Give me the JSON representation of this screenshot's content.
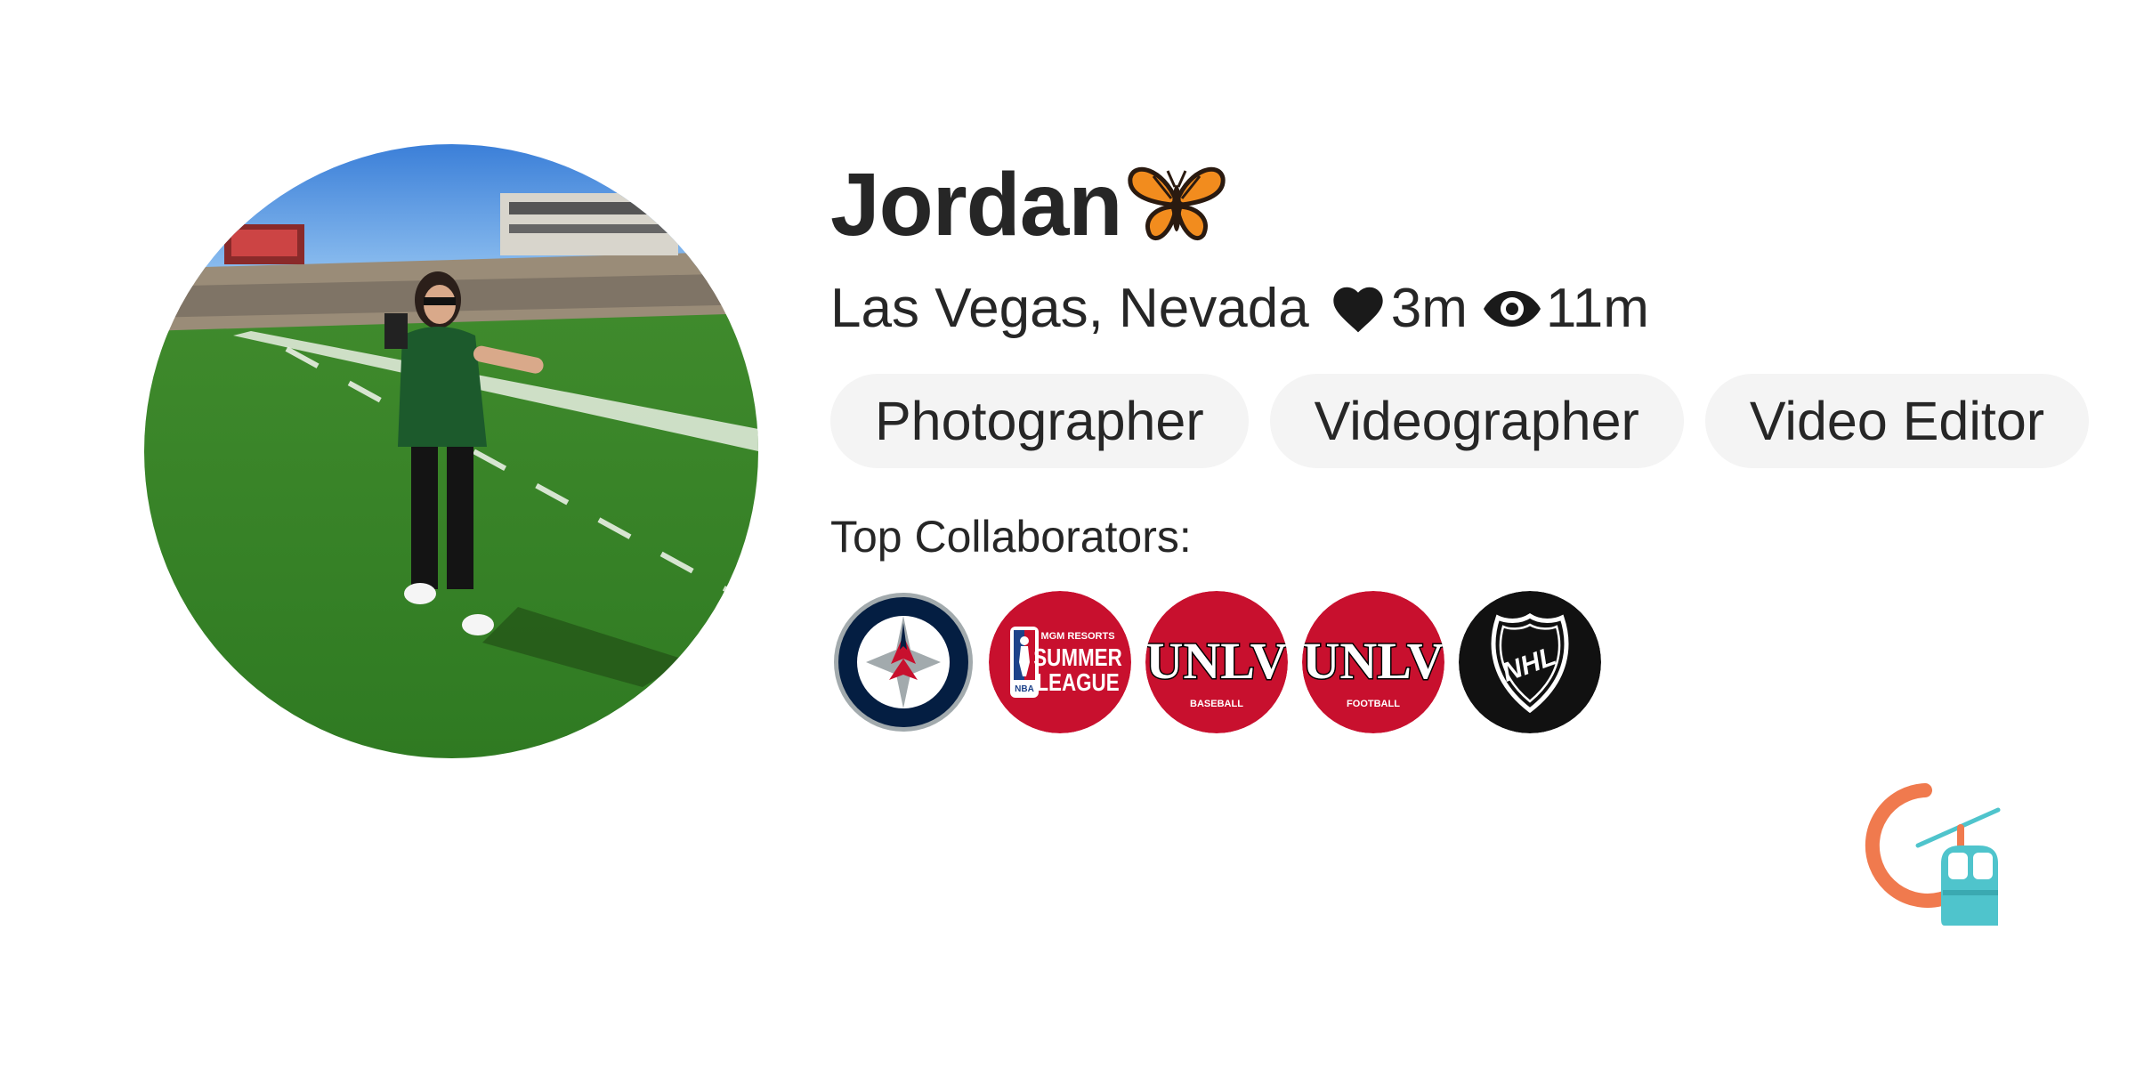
{
  "profile": {
    "name": "Jordan",
    "emoji_icon": "butterfly-icon",
    "location": "Las Vegas, Nevada",
    "likes": "3m",
    "views": "11m",
    "tags": [
      "Photographer",
      "Videographer",
      "Video Editor"
    ]
  },
  "collaborators": {
    "title": "Top Collaborators:",
    "logos": [
      {
        "icon": "winnipeg-jets-logo"
      },
      {
        "icon": "nba-summer-league-logo",
        "text_top": "MGM RESORTS",
        "text_main_1": "SUMMER",
        "text_main_2": "LEAGUE",
        "badge": "NBA"
      },
      {
        "icon": "unlv-baseball-logo",
        "text_main": "UNLV",
        "text_sub": "BASEBALL"
      },
      {
        "icon": "unlv-football-logo",
        "text_main": "UNLV",
        "text_sub": "FOOTBALL"
      },
      {
        "icon": "nhl-logo",
        "text_main": "NHL"
      }
    ]
  },
  "colors": {
    "text": "#262626",
    "tag_bg": "#f4f4f4",
    "unlv_red": "#c8102e",
    "jets_navy": "#041e42",
    "brand_orange": "#f07a4e",
    "brand_teal": "#4fc4cc"
  },
  "brand_icon": "gondola-logo-icon"
}
